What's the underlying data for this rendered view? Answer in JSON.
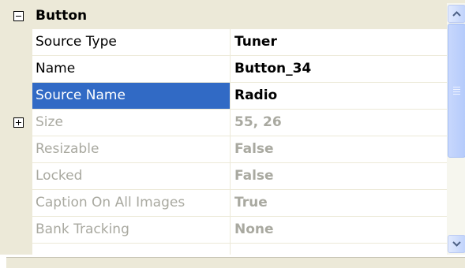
{
  "category": {
    "title": "Button",
    "expanded": true
  },
  "properties": [
    {
      "name": "Source Type",
      "value": "Tuner",
      "state": "normal"
    },
    {
      "name": "Name",
      "value": "Button_34",
      "state": "normal"
    },
    {
      "name": "Source Name",
      "value": "Radio",
      "state": "selected"
    },
    {
      "name": "Size",
      "value": "55, 26",
      "state": "disabled",
      "expandable": true
    },
    {
      "name": "Resizable",
      "value": "False",
      "state": "disabled"
    },
    {
      "name": "Locked",
      "value": "False",
      "state": "disabled"
    },
    {
      "name": "Caption On All Images",
      "value": "True",
      "state": "disabled"
    },
    {
      "name": "Bank Tracking",
      "value": "None",
      "state": "disabled"
    }
  ],
  "colors": {
    "selection": "#316ac5",
    "disabled_text": "#a9a9a0",
    "gutter": "#ece9d8"
  },
  "icons": {
    "collapse": "minus-box-icon",
    "expand": "plus-box-icon",
    "scroll_up": "chevron-up-icon",
    "scroll_down": "chevron-down-icon"
  }
}
